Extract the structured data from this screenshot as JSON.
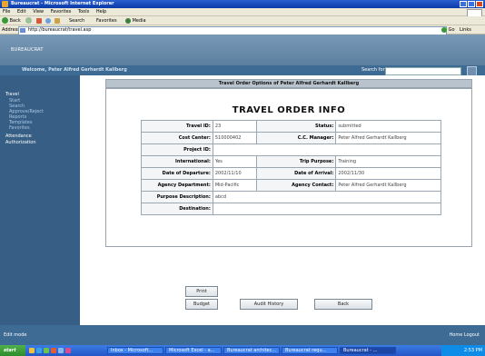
{
  "browser": {
    "title": "Bureaucrat - Microsoft Internet Explorer",
    "menu": [
      "File",
      "Edit",
      "View",
      "Favorites",
      "Tools",
      "Help"
    ],
    "toolbar": {
      "back": "Back",
      "search": "Search",
      "favorites": "Favorites",
      "media": "Media"
    },
    "address_label": "Address",
    "url": "http://bureaucrat/travel.asp",
    "go": "Go",
    "links": "Links"
  },
  "app": {
    "logo": "BUREAUCRAT",
    "welcome": "Welcome, Peter Alfred Gerhardt Kallberg",
    "header_link": "Search for:",
    "sidebar": [
      {
        "label": "Travel",
        "sub": [
          "Start",
          "Search",
          "Approve/Reject",
          "Reports",
          "Templates",
          "Favorites"
        ]
      },
      {
        "label": "Attendance",
        "sub": []
      },
      {
        "label": "Authorization",
        "sub": []
      }
    ],
    "section_title": "Travel Order Options of Peter Alfred Gerhardt Kallberg",
    "page_title": "TRAVEL ORDER INFO",
    "rows": [
      {
        "l1": "Travel ID:",
        "v1": "23",
        "l2": "Status:",
        "v2": "submitted"
      },
      {
        "l1": "Cost Center:",
        "v1": "510000402",
        "l2": "C.C. Manager:",
        "v2": "Peter Alfred Gerhardt Kallberg"
      },
      {
        "l1": "Project ID:",
        "v1": "",
        "l2": "",
        "v2": ""
      },
      {
        "l1": "International:",
        "v1": "Yes",
        "l2": "Trip Purpose:",
        "v2": "Training"
      },
      {
        "l1": "Date of Departure:",
        "v1": "2002/11/10",
        "l2": "Date of Arrival:",
        "v2": "2002/11/30"
      },
      {
        "l1": "Agency Department:",
        "v1": "Mid-Pacific",
        "l2": "Agency Contact:",
        "v2": "Peter Alfred Gerhardt Kallberg"
      },
      {
        "l1": "Purpose Description:",
        "v1": "abcd",
        "l2": "",
        "v2": ""
      },
      {
        "l1": "Destination:",
        "v1": "",
        "l2": "",
        "v2": ""
      }
    ],
    "buttons": {
      "print": "Print",
      "budget": "Budget",
      "audit": "Audit History",
      "back": "Back"
    },
    "footer_left": "Edit mode",
    "footer_right": "Home   Logout"
  },
  "taskbar": {
    "start": "start",
    "tasks": [
      "Inbox - Microsoft...",
      "Microsoft Excel - a...",
      "Bureaucrat architec...",
      "Bureaucrat requ...",
      "Bureaucrat - ..."
    ],
    "clock": "2:53 PM"
  }
}
